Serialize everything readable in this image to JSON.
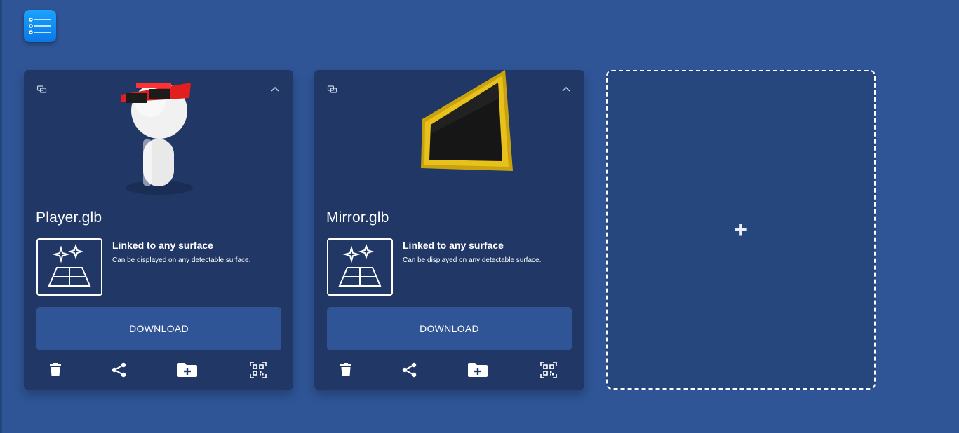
{
  "colors": {
    "background": "#2f5597",
    "card": "#213766",
    "button": "#2f5597",
    "menu_button": "#1492f5"
  },
  "menu": {
    "icon": "list-icon"
  },
  "cards": [
    {
      "title": "Player.glb",
      "preview": "player-model",
      "surface_title": "Linked to any surface",
      "surface_desc": "Can be displayed on any detectable surface.",
      "download_label": "DOWNLOAD",
      "actions": [
        "trash-icon",
        "share-icon",
        "folder-add-icon",
        "qr-code-icon"
      ]
    },
    {
      "title": "Mirror.glb",
      "preview": "mirror-model",
      "surface_title": "Linked to any surface",
      "surface_desc": "Can be displayed on any detectable surface.",
      "download_label": "DOWNLOAD",
      "actions": [
        "trash-icon",
        "share-icon",
        "folder-add-icon",
        "qr-code-icon"
      ]
    }
  ],
  "add_card": {
    "label": "+"
  }
}
